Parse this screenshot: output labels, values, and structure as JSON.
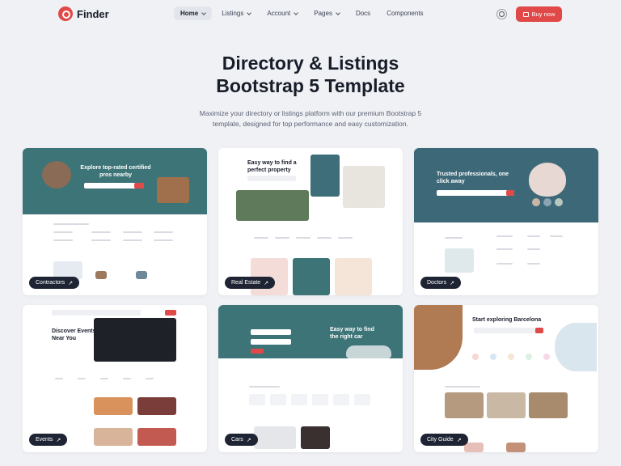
{
  "brand": {
    "name": "Finder"
  },
  "nav": {
    "items": [
      {
        "label": "Home",
        "dropdown": true,
        "active": true
      },
      {
        "label": "Listings",
        "dropdown": true
      },
      {
        "label": "Account",
        "dropdown": true
      },
      {
        "label": "Pages",
        "dropdown": true
      },
      {
        "label": "Docs",
        "dropdown": false
      },
      {
        "label": "Components",
        "dropdown": false
      }
    ],
    "theme_icon": "sun-icon",
    "buy_label": "Buy now"
  },
  "hero": {
    "title_line1": "Directory & Listings",
    "title_line2": "Bootstrap 5 Template",
    "subtitle_line1": "Maximize your directory or listings platform with our premium Bootstrap 5",
    "subtitle_line2": "template, designed for top performance and easy customization."
  },
  "cards": [
    {
      "badge": "Contractors",
      "heading": "Explore top-rated certified pros nearby"
    },
    {
      "badge": "Real Estate",
      "heading": "Easy way to find a perfect property"
    },
    {
      "badge": "Doctors",
      "heading": "Trusted professionals, one click away"
    },
    {
      "badge": "Events",
      "heading": "Discover Events Near You"
    },
    {
      "badge": "Cars",
      "heading": "Easy way to find the right car"
    },
    {
      "badge": "City Guide",
      "heading": "Start exploring Barcelona"
    }
  ],
  "colors": {
    "accent": "#e14848",
    "dark": "#181d2a",
    "teal": "#3d7478",
    "background": "#f0f1f5"
  }
}
